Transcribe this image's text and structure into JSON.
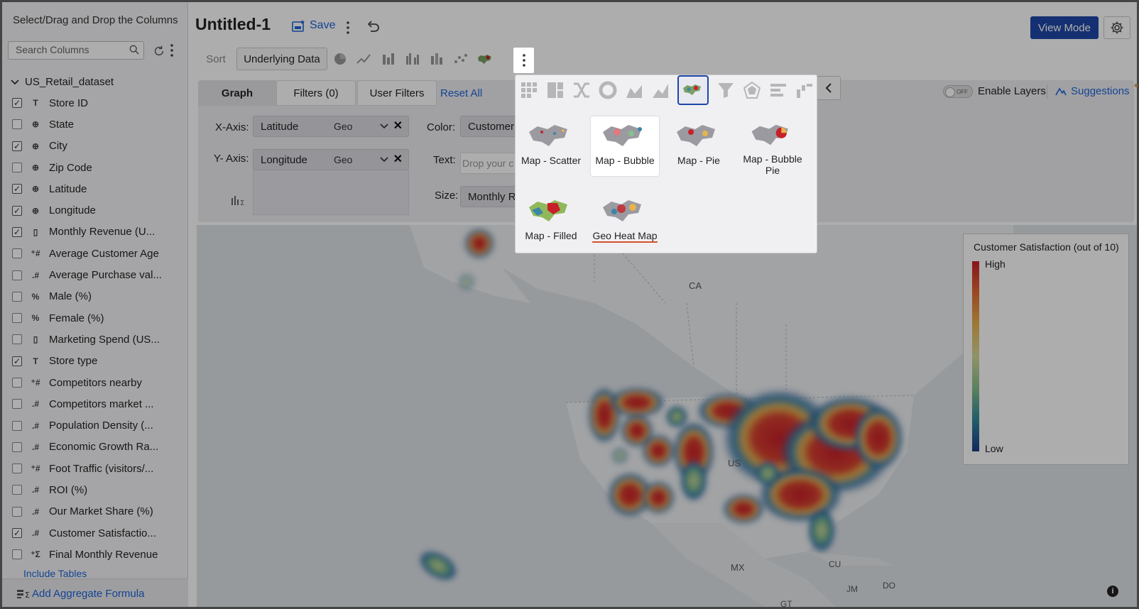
{
  "left_panel": {
    "title": "Select/Drag and Drop the Columns",
    "search_placeholder": "Search Columns",
    "dataset": "US_Retail_dataset",
    "columns": [
      {
        "label": "Store ID",
        "checked": true,
        "type": "T"
      },
      {
        "label": "State",
        "checked": false,
        "type": "geo"
      },
      {
        "label": "City",
        "checked": true,
        "type": "geo"
      },
      {
        "label": "Zip Code",
        "checked": false,
        "type": "geo"
      },
      {
        "label": "Latitude",
        "checked": true,
        "type": "geo"
      },
      {
        "label": "Longitude",
        "checked": true,
        "type": "geo"
      },
      {
        "label": "Monthly Revenue (U...",
        "checked": true,
        "type": "currency"
      },
      {
        "label": "Average Customer Age",
        "checked": false,
        "type": "+#"
      },
      {
        "label": "Average Purchase val...",
        "checked": false,
        "type": ".#"
      },
      {
        "label": "Male (%)",
        "checked": false,
        "type": "%"
      },
      {
        "label": "Female (%)",
        "checked": false,
        "type": "%"
      },
      {
        "label": "Marketing Spend (US...",
        "checked": false,
        "type": "currency"
      },
      {
        "label": "Store type",
        "checked": true,
        "type": "T"
      },
      {
        "label": "Competitors nearby",
        "checked": false,
        "type": "+#"
      },
      {
        "label": "Competitors market ...",
        "checked": false,
        "type": ".#"
      },
      {
        "label": "Population Density (...",
        "checked": false,
        "type": ".#"
      },
      {
        "label": "Economic Growth Ra...",
        "checked": false,
        "type": ".#"
      },
      {
        "label": "Foot Traffic (visitors/...",
        "checked": false,
        "type": "+#"
      },
      {
        "label": "ROI (%)",
        "checked": false,
        "type": ".#"
      },
      {
        "label": "Our Market Share (%)",
        "checked": false,
        "type": ".#"
      },
      {
        "label": "Customer Satisfactio...",
        "checked": true,
        "type": ".#"
      },
      {
        "label": "Final Monthly Revenue",
        "checked": false,
        "type": "formula"
      }
    ],
    "include_tables": "Include Tables",
    "add_aggregate": "Add Aggregate Formula"
  },
  "header": {
    "title": "Untitled-1",
    "save": "Save",
    "view_mode": "View Mode"
  },
  "toolbar": {
    "sort": "Sort",
    "underlying": "Underlying Data"
  },
  "tabs": {
    "graph": "Graph",
    "filters": "Filters  (0)",
    "user_filters": "User Filters",
    "reset_all": "Reset All",
    "enable_layers": "Enable Layers",
    "toggle_state": "OFF",
    "suggestions": "Suggestions"
  },
  "shelves": {
    "x_label": "X-Axis:",
    "x_value": "Latitude",
    "x_type": "Geo",
    "y_label": "Y- Axis:",
    "y_value": "Longitude",
    "y_type": "Geo",
    "color_label": "Color:",
    "color_value": "Customer",
    "text_label": "Text:",
    "text_placeholder": "Drop your c",
    "size_label": "Size:",
    "size_value": "Monthly R"
  },
  "map": {
    "labels": {
      "ca": "CA",
      "us": "US",
      "mx": "MX",
      "cu": "CU",
      "jm": "JM",
      "do": "DO",
      "gt": "GT"
    },
    "legend_title": "Customer Satisfaction (out of 10)",
    "legend_high": "High",
    "legend_low": "Low",
    "colors": {
      "high": "#c8202a",
      "mid": "#e6b44e",
      "low": "#1e3c8a"
    }
  },
  "popup": {
    "options": [
      {
        "label": "Map - Scatter",
        "selected": false
      },
      {
        "label": "Map - Bubble",
        "selected": true
      },
      {
        "label": "Map - Pie",
        "selected": false
      },
      {
        "label": "Map - Bubble Pie",
        "selected": false
      },
      {
        "label": "Map - Filled",
        "selected": false
      },
      {
        "label": "Geo Heat Map",
        "selected": false
      }
    ]
  }
}
